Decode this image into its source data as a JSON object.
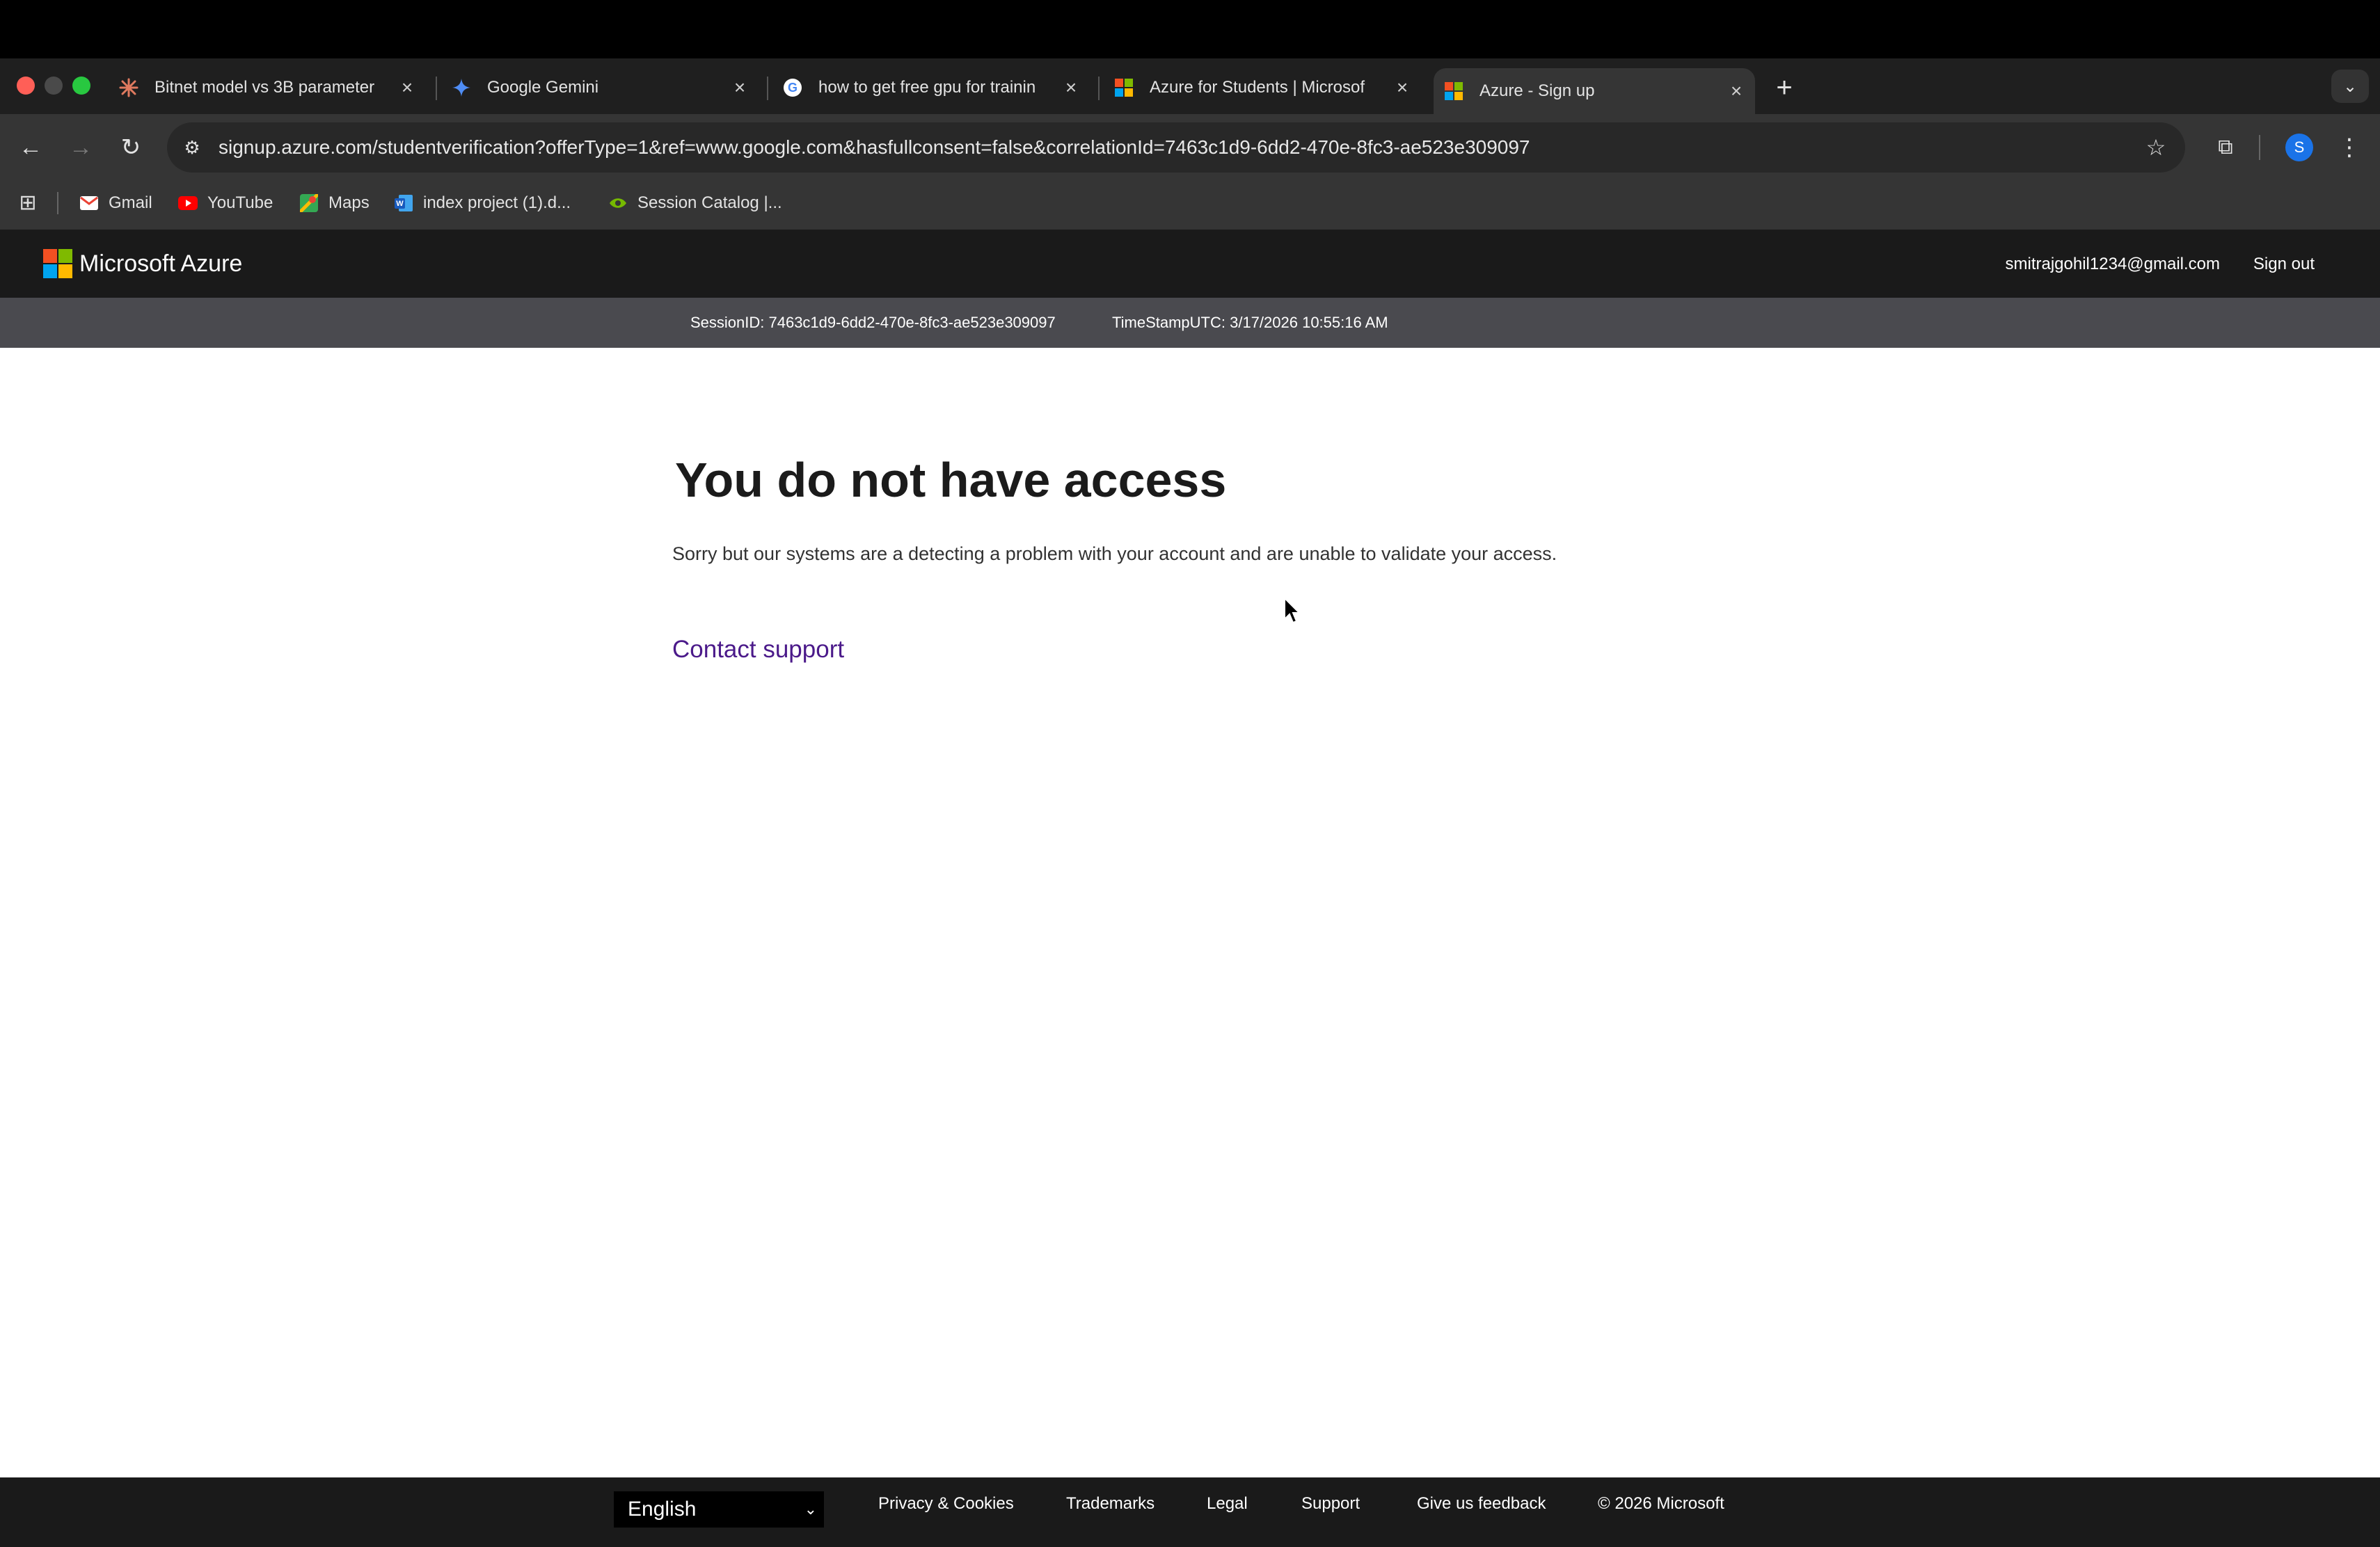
{
  "browser": {
    "tabs": [
      {
        "title": "Bitnet model vs 3B parameter",
        "favicon": "asterisk-icon",
        "active": false
      },
      {
        "title": "Google Gemini",
        "favicon": "gemini-sparkle-icon",
        "active": false
      },
      {
        "title": "how to get free gpu for trainin",
        "favicon": "google-g-icon",
        "active": false
      },
      {
        "title": "Azure for Students | Microsof",
        "favicon": "microsoft-logo-icon",
        "active": false
      },
      {
        "title": "Azure - Sign up",
        "favicon": "microsoft-logo-icon",
        "active": true
      }
    ],
    "url": "signup.azure.com/studentverification?offerType=1&ref=www.google.com&hasfullconsent=false&correlationId=7463c1d9-6dd2-470e-8fc3-ae523e309097",
    "profile_initial": "S",
    "bookmarks": [
      {
        "label": "Gmail",
        "icon": "gmail-icon"
      },
      {
        "label": "YouTube",
        "icon": "youtube-icon"
      },
      {
        "label": "Maps",
        "icon": "maps-icon"
      },
      {
        "label": "index project (1).d...",
        "icon": "word-doc-icon"
      },
      {
        "label": "Session Catalog |...",
        "icon": "nvidia-icon"
      }
    ]
  },
  "azure": {
    "brand": "Microsoft Azure",
    "email": "smitrajgohil1234@gmail.com",
    "signout_label": "Sign out",
    "session_id": "SessionID: 7463c1d9-6dd2-470e-8fc3-ae523e309097",
    "timestamp": "TimeStampUTC: 3/17/2026 10:55:16 AM",
    "heading": "You do not have access",
    "message": "Sorry but our systems are a detecting a problem with your account and are unable to validate your access.",
    "contact_label": "Contact support"
  },
  "footer": {
    "language": "English",
    "links": [
      "Privacy & Cookies",
      "Trademarks",
      "Legal",
      "Support",
      "Give us feedback"
    ],
    "copyright": "© 2026 Microsoft"
  },
  "colors": {
    "ms_red": "#f25022",
    "ms_green": "#7fba00",
    "ms_blue": "#00a4ef",
    "ms_yellow": "#ffb900",
    "link_purple": "#4b1a8a"
  }
}
